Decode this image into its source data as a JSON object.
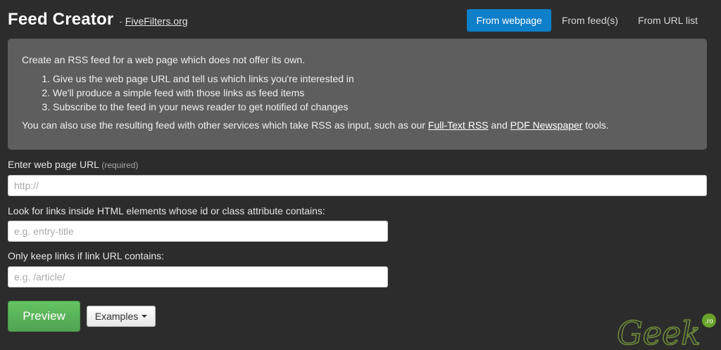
{
  "header": {
    "title": "Feed Creator",
    "separator": "-",
    "site_link": "FiveFilters.org"
  },
  "tabs": [
    {
      "label": "From webpage",
      "active": true
    },
    {
      "label": "From feed(s)",
      "active": false
    },
    {
      "label": "From URL list",
      "active": false
    }
  ],
  "info": {
    "intro": "Create an RSS feed for a web page which does not offer its own.",
    "steps": [
      "Give us the web page URL and tell us which links you're interested in",
      "We'll produce a simple feed with those links as feed items",
      "Subscribe to the feed in your news reader to get notified of changes"
    ],
    "outro_prefix": "You can also use the resulting feed with other services which take RSS as input, such as our ",
    "link1": "Full-Text RSS",
    "outro_and": " and ",
    "link2": "PDF Newspaper",
    "outro_suffix": " tools."
  },
  "form": {
    "url_label": "Enter web page URL",
    "url_hint": "(required)",
    "url_placeholder": "http://",
    "url_value": "",
    "element_label": "Look for links inside HTML elements whose id or class attribute contains:",
    "element_placeholder": "e.g. entry-title",
    "element_value": "",
    "keep_label": "Only keep links if link URL contains:",
    "keep_placeholder": "e.g. /article/",
    "keep_value": ""
  },
  "buttons": {
    "preview": "Preview",
    "examples": "Examples"
  },
  "watermark": {
    "text": "Geek",
    "badge": ".ro"
  },
  "colors": {
    "background": "#2c2c2c",
    "info_box": "#5e5e5e",
    "active_tab": "#0e7fc9",
    "preview_button": "#5bb75b"
  }
}
